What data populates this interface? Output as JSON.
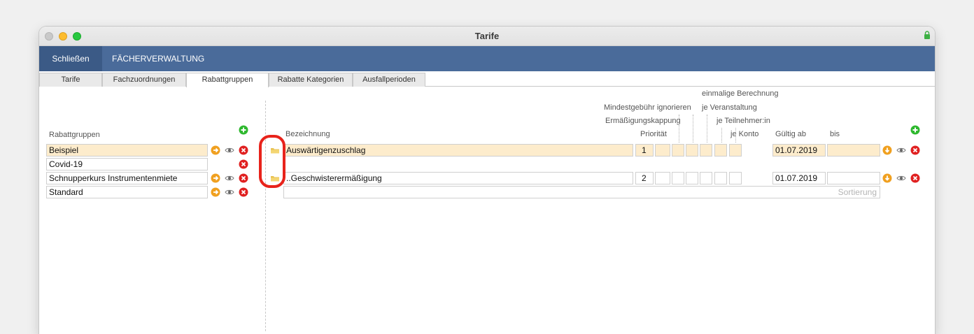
{
  "window": {
    "title": "Tarife"
  },
  "menubar": {
    "close_label": "Schließen",
    "module_label": "FÄCHERVERWALTUNG"
  },
  "tabs": [
    {
      "label": "Tarife"
    },
    {
      "label": "Fachzuordnungen"
    },
    {
      "label": "Rabattgruppen"
    },
    {
      "label": "Rabatte Kategorien"
    },
    {
      "label": "Ausfallperioden"
    }
  ],
  "active_tab": "Rabattgruppen",
  "left": {
    "header": "Rabattgruppen",
    "items": [
      {
        "label": "Beispiel",
        "highlighted": true
      },
      {
        "label": "Covid-19",
        "highlighted": false
      },
      {
        "label": "Schnupperkurs Instrumentenmiete",
        "highlighted": false
      },
      {
        "label": "Standard",
        "highlighted": false
      }
    ]
  },
  "right": {
    "headers": {
      "bezeichnung": "Bezeichnung",
      "einmalige": "einmalige Berechnung",
      "mindestgebuehr": "Mindestgebühr ignorieren",
      "je_veranstaltung": "je Veranstaltung",
      "ermaessigungskappung": "Ermäßigungskappung",
      "je_teilnehmer": "je Teilnehmer:in",
      "prioritaet": "Priorität",
      "je_konto": "je Konto",
      "gueltig_ab": "Gültig ab",
      "bis": "bis"
    },
    "rows": [
      {
        "bezeichnung": "Auswärtigenzuschlag",
        "prioritaet": "1",
        "gueltig_ab": "01.07.2019",
        "bis": "",
        "highlighted": true
      },
      {
        "bezeichnung": "..Geschwisterermäßigung",
        "prioritaet": "2",
        "gueltig_ab": "01.07.2019",
        "bis": "",
        "highlighted": false
      }
    ],
    "sort_placeholder": "Sortierung"
  },
  "colors": {
    "menubar": "#4a6b9a",
    "highlight": "#fdeccc",
    "accent_orange": "#f0a020",
    "delete_red": "#e02020",
    "add_green": "#2eb82e",
    "annotation": "#e8231b"
  },
  "icons": [
    "lock-icon",
    "add-icon",
    "arrow-right-icon",
    "arrow-down-icon",
    "eye-icon",
    "delete-icon",
    "folder-icon"
  ]
}
